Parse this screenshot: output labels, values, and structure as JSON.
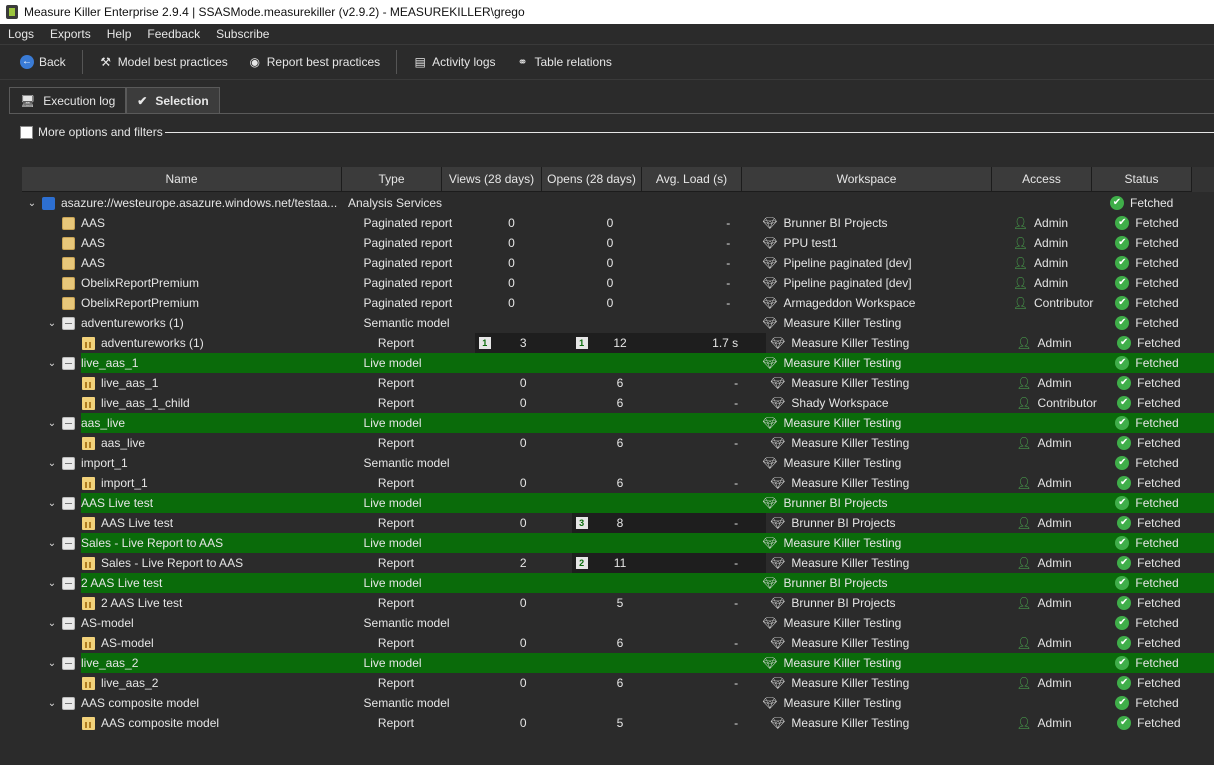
{
  "window": {
    "title": "Measure Killer Enterprise 2.9.4 | SSASMode.measurekiller (v2.9.2) - MEASUREKILLER\\grego"
  },
  "menu": [
    "Logs",
    "Exports",
    "Help",
    "Feedback",
    "Subscribe"
  ],
  "toolbar": {
    "back": "Back",
    "model_best_practices": "Model best practices",
    "report_best_practices": "Report best practices",
    "activity_logs": "Activity logs",
    "table_relations": "Table relations"
  },
  "tabs": {
    "execution_log": "Execution log",
    "selection": "Selection"
  },
  "options": {
    "more_options": "More options and filters"
  },
  "columns": [
    "Name",
    "Type",
    "Views (28 days)",
    "Opens (28 days)",
    "Avg. Load (s)",
    "Workspace",
    "Access",
    "Status"
  ],
  "colors": {
    "live_row": "#0a6b0a",
    "active_cell": "#1e1e1e",
    "status_ok": "#3fae49"
  },
  "rows": [
    {
      "level": 0,
      "exp": "v",
      "icon": "server",
      "name": "asazure://westeurope.asazure.windows.net/testaa...",
      "type": "Analysis Services",
      "views": "",
      "opens": "",
      "load": "",
      "ws": "",
      "acc": "",
      "status": "Fetched"
    },
    {
      "level": 1,
      "exp": "",
      "icon": "paginated",
      "name": "AAS",
      "type": "Paginated report",
      "views": "0",
      "opens": "0",
      "load": "-",
      "ws": "Brunner BI Projects",
      "acc": "Admin",
      "status": "Fetched"
    },
    {
      "level": 1,
      "exp": "",
      "icon": "paginated",
      "name": "AAS",
      "type": "Paginated report",
      "views": "0",
      "opens": "0",
      "load": "-",
      "ws": "PPU test1",
      "acc": "Admin",
      "status": "Fetched"
    },
    {
      "level": 1,
      "exp": "",
      "icon": "paginated",
      "name": "AAS",
      "type": "Paginated report",
      "views": "0",
      "opens": "0",
      "load": "-",
      "ws": "Pipeline paginated [dev]",
      "acc": "Admin",
      "status": "Fetched"
    },
    {
      "level": 1,
      "exp": "",
      "icon": "paginated",
      "name": "ObelixReportPremium",
      "type": "Paginated report",
      "views": "0",
      "opens": "0",
      "load": "-",
      "ws": "Pipeline paginated [dev]",
      "acc": "Admin",
      "status": "Fetched"
    },
    {
      "level": 1,
      "exp": "",
      "icon": "paginated",
      "name": "ObelixReportPremium",
      "type": "Paginated report",
      "views": "0",
      "opens": "0",
      "load": "-",
      "ws": "Armageddon Workspace",
      "acc": "Contributor",
      "status": "Fetched"
    },
    {
      "level": 1,
      "exp": "v",
      "icon": "model",
      "name": "adventureworks (1)",
      "type": "Semantic model",
      "views": "",
      "opens": "",
      "load": "",
      "ws": "Measure Killer Testing",
      "acc": "",
      "status": "Fetched"
    },
    {
      "level": 2,
      "exp": "",
      "icon": "report",
      "name": "adventureworks (1)",
      "type": "Report",
      "views": "3",
      "opens": "12",
      "load": "1.7 s",
      "ws": "Measure Killer Testing",
      "acc": "Admin",
      "status": "Fetched",
      "views_rank": "1",
      "opens_rank": "1",
      "hl": "va"
    },
    {
      "level": 1,
      "exp": "v",
      "icon": "model",
      "name": "live_aas_1",
      "type": "Live model",
      "views": "",
      "opens": "",
      "load": "",
      "ws": "Measure Killer Testing",
      "acc": "",
      "status": "Fetched",
      "live": true
    },
    {
      "level": 2,
      "exp": "",
      "icon": "report",
      "name": "live_aas_1",
      "type": "Report",
      "views": "0",
      "opens": "6",
      "load": "-",
      "ws": "Measure Killer Testing",
      "acc": "Admin",
      "status": "Fetched"
    },
    {
      "level": 2,
      "exp": "",
      "icon": "report",
      "name": "live_aas_1_child",
      "type": "Report",
      "views": "0",
      "opens": "6",
      "load": "-",
      "ws": "Shady Workspace",
      "acc": "Contributor",
      "status": "Fetched"
    },
    {
      "level": 1,
      "exp": "v",
      "icon": "model",
      "name": "aas_live",
      "type": "Live model",
      "views": "",
      "opens": "",
      "load": "",
      "ws": "Measure Killer Testing",
      "acc": "",
      "status": "Fetched",
      "live": true
    },
    {
      "level": 2,
      "exp": "",
      "icon": "report",
      "name": "aas_live",
      "type": "Report",
      "views": "0",
      "opens": "6",
      "load": "-",
      "ws": "Measure Killer Testing",
      "acc": "Admin",
      "status": "Fetched"
    },
    {
      "level": 1,
      "exp": "v",
      "icon": "model",
      "name": "import_1",
      "type": "Semantic model",
      "views": "",
      "opens": "",
      "load": "",
      "ws": "Measure Killer Testing",
      "acc": "",
      "status": "Fetched"
    },
    {
      "level": 2,
      "exp": "",
      "icon": "report",
      "name": "import_1",
      "type": "Report",
      "views": "0",
      "opens": "6",
      "load": "-",
      "ws": "Measure Killer Testing",
      "acc": "Admin",
      "status": "Fetched"
    },
    {
      "level": 1,
      "exp": "v",
      "icon": "model",
      "name": "AAS Live test",
      "type": "Live model",
      "views": "",
      "opens": "",
      "load": "",
      "ws": "Brunner BI Projects",
      "acc": "",
      "status": "Fetched",
      "live": true
    },
    {
      "level": 2,
      "exp": "",
      "icon": "report",
      "name": "AAS Live test",
      "type": "Report",
      "views": "0",
      "opens": "8",
      "load": "-",
      "ws": "Brunner BI Projects",
      "acc": "Admin",
      "status": "Fetched",
      "opens_rank": "3",
      "hl": "vl"
    },
    {
      "level": 1,
      "exp": "v",
      "icon": "model",
      "name": "Sales - Live Report to AAS",
      "type": "Live model",
      "views": "",
      "opens": "",
      "load": "",
      "ws": "Measure Killer Testing",
      "acc": "",
      "status": "Fetched",
      "live": true
    },
    {
      "level": 2,
      "exp": "",
      "icon": "report",
      "name": "Sales - Live Report to AAS",
      "type": "Report",
      "views": "2",
      "opens": "11",
      "load": "-",
      "ws": "Measure Killer Testing",
      "acc": "Admin",
      "status": "Fetched",
      "opens_rank": "2",
      "hl": "vl"
    },
    {
      "level": 1,
      "exp": "v",
      "icon": "model",
      "name": "2 AAS Live test",
      "type": "Live model",
      "views": "",
      "opens": "",
      "load": "",
      "ws": "Brunner BI Projects",
      "acc": "",
      "status": "Fetched",
      "live": true
    },
    {
      "level": 2,
      "exp": "",
      "icon": "report",
      "name": "2 AAS Live test",
      "type": "Report",
      "views": "0",
      "opens": "5",
      "load": "-",
      "ws": "Brunner BI Projects",
      "acc": "Admin",
      "status": "Fetched"
    },
    {
      "level": 1,
      "exp": "v",
      "icon": "model",
      "name": "AS-model",
      "type": "Semantic model",
      "views": "",
      "opens": "",
      "load": "",
      "ws": "Measure Killer Testing",
      "acc": "",
      "status": "Fetched"
    },
    {
      "level": 2,
      "exp": "",
      "icon": "report",
      "name": "AS-model",
      "type": "Report",
      "views": "0",
      "opens": "6",
      "load": "-",
      "ws": "Measure Killer Testing",
      "acc": "Admin",
      "status": "Fetched"
    },
    {
      "level": 1,
      "exp": "v",
      "icon": "model",
      "name": "live_aas_2",
      "type": "Live model",
      "views": "",
      "opens": "",
      "load": "",
      "ws": "Measure Killer Testing",
      "acc": "",
      "status": "Fetched",
      "live": true
    },
    {
      "level": 2,
      "exp": "",
      "icon": "report",
      "name": "live_aas_2",
      "type": "Report",
      "views": "0",
      "opens": "6",
      "load": "-",
      "ws": "Measure Killer Testing",
      "acc": "Admin",
      "status": "Fetched"
    },
    {
      "level": 1,
      "exp": "v",
      "icon": "model",
      "name": "AAS composite model",
      "type": "Semantic model",
      "views": "",
      "opens": "",
      "load": "",
      "ws": "Measure Killer Testing",
      "acc": "",
      "status": "Fetched"
    },
    {
      "level": 2,
      "exp": "",
      "icon": "report",
      "name": "AAS composite model",
      "type": "Report",
      "views": "0",
      "opens": "5",
      "load": "-",
      "ws": "Measure Killer Testing",
      "acc": "Admin",
      "status": "Fetched"
    }
  ]
}
